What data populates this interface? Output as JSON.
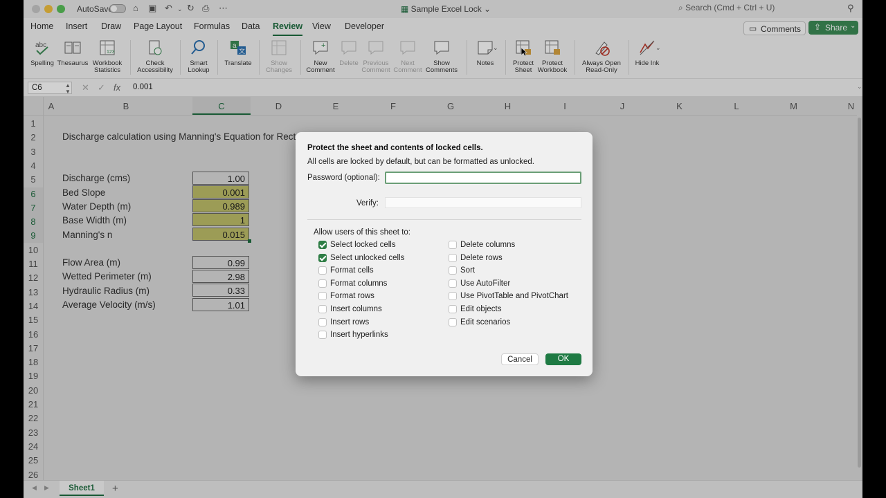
{
  "titlebar": {
    "autosave_label": "AutoSave",
    "doc_title": "Sample Excel Lock",
    "search_placeholder": "Search (Cmd + Ctrl + U)"
  },
  "tabs": [
    "Home",
    "Insert",
    "Draw",
    "Page Layout",
    "Formulas",
    "Data",
    "Review",
    "View",
    "Developer"
  ],
  "active_tab": "Review",
  "header_buttons": {
    "comments": "Comments",
    "share": "Share"
  },
  "ribbon": {
    "spelling": "Spelling",
    "thesaurus": "Thesaurus",
    "workbook_statistics": [
      "Workbook",
      "Statistics"
    ],
    "check_accessibility": [
      "Check",
      "Accessibility"
    ],
    "smart_lookup": [
      "Smart",
      "Lookup"
    ],
    "translate": "Translate",
    "show_changes": [
      "Show",
      "Changes"
    ],
    "new_comment": [
      "New",
      "Comment"
    ],
    "delete": "Delete",
    "previous_comment": [
      "Previous",
      "Comment"
    ],
    "next_comment": [
      "Next",
      "Comment"
    ],
    "show_comments": [
      "Show",
      "Comments"
    ],
    "notes": "Notes",
    "protect_sheet": [
      "Protect",
      "Sheet"
    ],
    "protect_workbook": [
      "Protect",
      "Workbook"
    ],
    "always_open_readonly": [
      "Always Open",
      "Read-Only"
    ],
    "hide_ink": "Hide Ink"
  },
  "formula_bar": {
    "name_box": "C6",
    "fx": "fx",
    "value": "0.001"
  },
  "columns": [
    "A",
    "B",
    "C",
    "D",
    "E",
    "F",
    "G",
    "H",
    "I",
    "J",
    "K",
    "L",
    "M",
    "N"
  ],
  "rows": [
    "1",
    "2",
    "3",
    "4",
    "5",
    "6",
    "7",
    "8",
    "9",
    "10",
    "11",
    "12",
    "13",
    "14",
    "15",
    "16",
    "17",
    "18",
    "19",
    "20",
    "21",
    "22",
    "23",
    "24",
    "25",
    "26"
  ],
  "sheet": {
    "title": "Discharge calculation using Manning's Equation for Rect",
    "inputs": [
      {
        "label": "Discharge (cms)",
        "value": "1.00"
      },
      {
        "label": "Bed Slope",
        "value": "0.001"
      },
      {
        "label": "Water Depth (m)",
        "value": "0.989"
      },
      {
        "label": "Base Width (m)",
        "value": "1"
      },
      {
        "label": "Manning's n",
        "value": "0.015"
      }
    ],
    "outputs": [
      {
        "label": "Flow Area (m)",
        "value": "0.99"
      },
      {
        "label": "Wetted Perimeter (m)",
        "value": "2.98"
      },
      {
        "label": "Hydraulic Radius (m)",
        "value": "0.33"
      },
      {
        "label": "Average Velocity (m/s)",
        "value": "1.01"
      }
    ]
  },
  "sheet_tabs": {
    "active": "Sheet1",
    "add": "+"
  },
  "dialog": {
    "title": "Protect the sheet and contents of locked cells.",
    "subtitle": "All cells are locked by default, but can be formatted as unlocked.",
    "password_label": "Password (optional):",
    "verify_label": "Verify:",
    "allow_label": "Allow users of this sheet to:",
    "left_options": [
      {
        "label": "Select locked cells",
        "checked": true
      },
      {
        "label": "Select unlocked cells",
        "checked": true
      },
      {
        "label": "Format cells",
        "checked": false
      },
      {
        "label": "Format columns",
        "checked": false
      },
      {
        "label": "Format rows",
        "checked": false
      },
      {
        "label": "Insert columns",
        "checked": false
      },
      {
        "label": "Insert rows",
        "checked": false
      },
      {
        "label": "Insert hyperlinks",
        "checked": false
      }
    ],
    "right_options": [
      {
        "label": "Delete columns",
        "checked": false
      },
      {
        "label": "Delete rows",
        "checked": false
      },
      {
        "label": "Sort",
        "checked": false
      },
      {
        "label": "Use AutoFilter",
        "checked": false
      },
      {
        "label": "Use PivotTable and PivotChart",
        "checked": false
      },
      {
        "label": "Edit objects",
        "checked": false
      },
      {
        "label": "Edit scenarios",
        "checked": false
      }
    ],
    "cancel": "Cancel",
    "ok": "OK"
  },
  "colors": {
    "accent": "#1e6d40",
    "share": "#3c8b56",
    "ok": "#1e7a43",
    "selection": "#bfbf6a"
  }
}
